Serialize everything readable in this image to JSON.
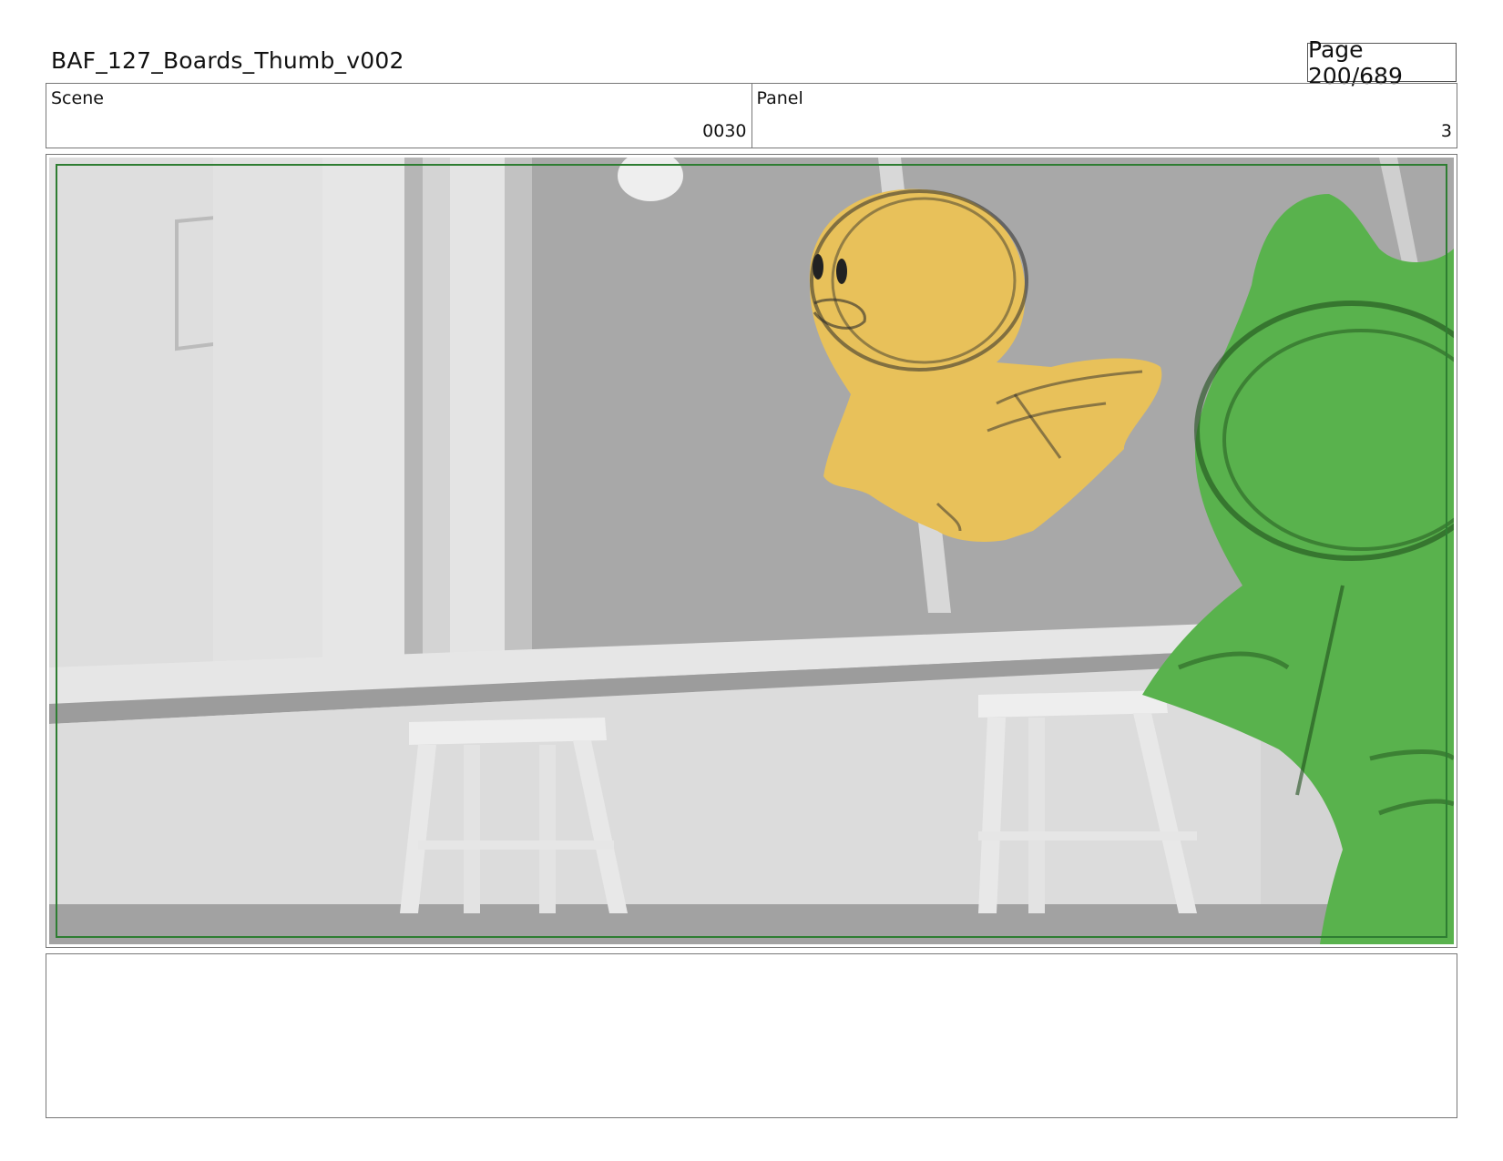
{
  "header": {
    "document_title": "BAF_127_Boards_Thumb_v002",
    "page_label": "Page 200/689"
  },
  "info": {
    "scene_label": "Scene",
    "scene_value": "0030",
    "panel_label": "Panel",
    "panel_value": "3"
  },
  "frame": {
    "description_icon": "storyboard-panel-image",
    "safe_frame_color": "#2e7d32",
    "yellow_character_color": "#e8c15a",
    "green_character_color": "#59b24d"
  },
  "notes": {
    "text": ""
  }
}
